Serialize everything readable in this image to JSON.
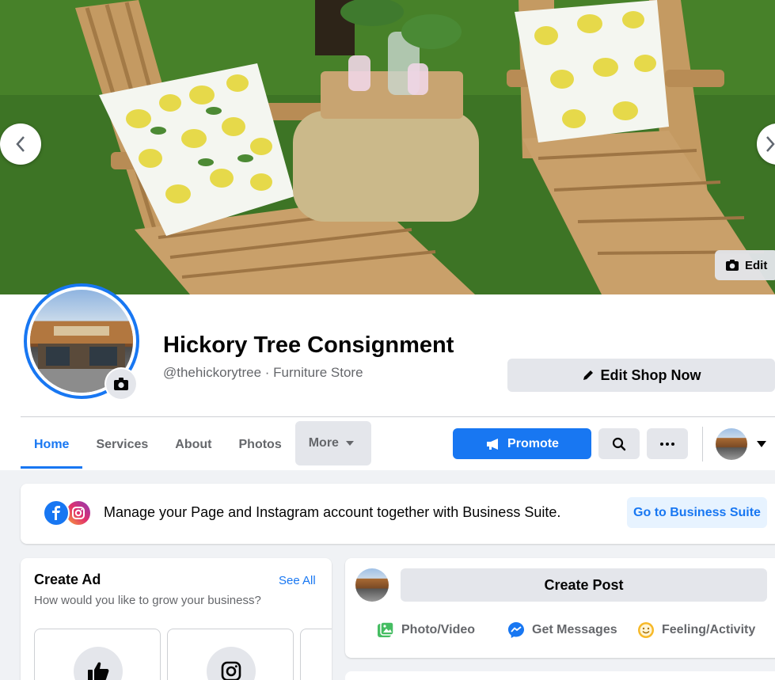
{
  "cover": {
    "edit_label": "Edit"
  },
  "profile": {
    "page_name": "Hickory Tree Consignment",
    "handle_category": "@thehickorytree · Furniture Store",
    "edit_shop_label": "Edit Shop Now"
  },
  "tabs": [
    {
      "label": "Home",
      "active": true
    },
    {
      "label": "Services"
    },
    {
      "label": "About"
    },
    {
      "label": "Photos"
    },
    {
      "label": "More"
    }
  ],
  "actions": {
    "promote_label": "Promote"
  },
  "banner": {
    "text": "Manage your Page and Instagram account together with Business Suite.",
    "button_label": "Go to Business Suite"
  },
  "create_ad": {
    "title": "Create Ad",
    "see_all": "See All",
    "subtitle": "How would you like to grow your business?"
  },
  "create_post": {
    "button_label": "Create Post",
    "actions": [
      {
        "label": "Photo/Video",
        "icon": "photo-video-icon"
      },
      {
        "label": "Get Messages",
        "icon": "messenger-icon"
      },
      {
        "label": "Feeling/Activity",
        "icon": "smiley-icon"
      }
    ]
  },
  "colors": {
    "accent": "#1877f2",
    "background": "#f0f2f5",
    "button_gray": "#e4e6eb",
    "secondary_text": "#65676b"
  }
}
